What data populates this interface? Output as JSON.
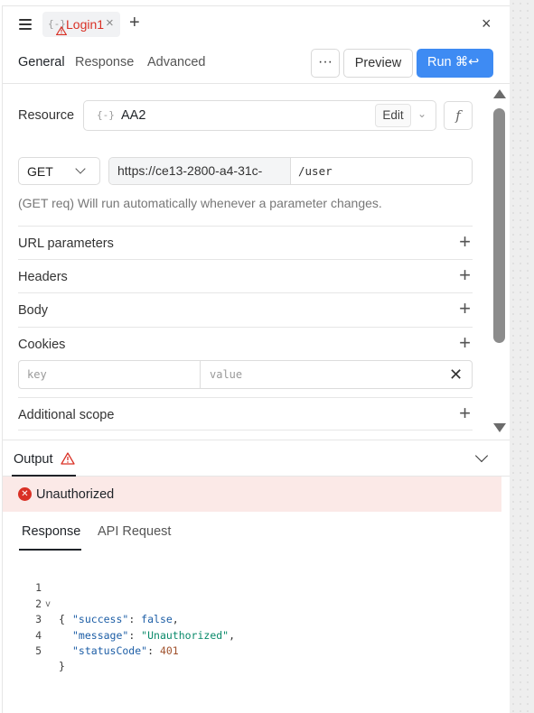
{
  "tabbar": {
    "tab_icon": "{-}",
    "tab_label": "Login1",
    "tab_close": "×",
    "add_tab": "+",
    "close_panel": "×"
  },
  "toolbar": {
    "tabs": [
      "General",
      "Response",
      "Advanced"
    ],
    "more": "···",
    "preview": "Preview",
    "run": "Run ⌘↩"
  },
  "config": {
    "resource_label": "Resource",
    "resource_icon": "{-}",
    "resource_name": "AA2",
    "edit": "Edit",
    "chevron": "⌄",
    "fx": "f",
    "method": "GET",
    "url_base": "https://ce13-2800-a4-31c-",
    "url_path": "/user",
    "hint": "(GET req) Will run automatically whenever a parameter changes."
  },
  "sections": {
    "url_parameters": "URL parameters",
    "headers": "Headers",
    "body": "Body",
    "cookies": "Cookies",
    "additional_scope": "Additional scope"
  },
  "cookies": {
    "key_placeholder": "key",
    "value_placeholder": "value",
    "remove": "✕"
  },
  "output": {
    "title": "Output",
    "error_text": "Unauthorized",
    "error_icon": "✕",
    "tabs": [
      "Response",
      "API Request"
    ]
  },
  "code": {
    "line_numbers": [
      "1",
      "2",
      "3",
      "4",
      "5"
    ],
    "fold_marker": "v",
    "open_brace": "{",
    "close_brace": "}",
    "success_key": "\"success\"",
    "success_val": "false",
    "message_key": "\"message\"",
    "message_val": "\"Unauthorized\"",
    "status_key": "\"statusCode\"",
    "status_val": "401"
  },
  "colors": {
    "accent": "#3e8bf3",
    "error": "#d93025",
    "error_bg": "#fbe9e7"
  }
}
